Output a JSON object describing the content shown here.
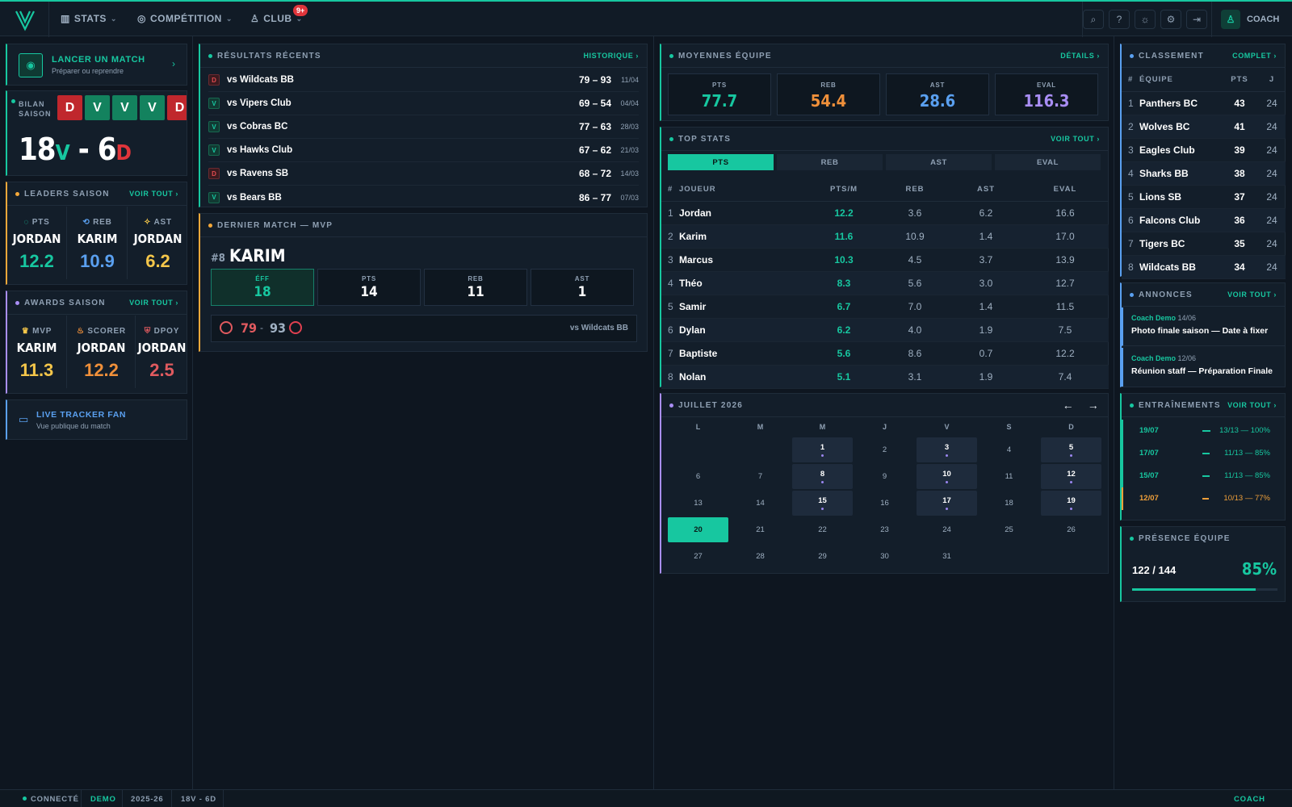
{
  "nav": {
    "stats": "STATS",
    "competition": "COMPÉTITION",
    "club": "CLUB",
    "club_badge": "9+",
    "user": "COACH"
  },
  "colors": {
    "accent": "#17c7a0",
    "loss": "#c0272d",
    "win": "#13825e",
    "orange": "#f0903a",
    "blue": "#5aa0f0",
    "purple": "#a98ef5",
    "yellow": "#f4c64a",
    "red": "#e05a5f"
  },
  "launch": {
    "title": "LANCER UN MATCH",
    "subtitle": "Préparer ou reprendre"
  },
  "bilan": {
    "label1": "BILAN",
    "label2": "SAISON",
    "form": [
      "D",
      "V",
      "V",
      "V",
      "D"
    ],
    "wins": "18",
    "win_suffix": "V",
    "dash": "-",
    "losses": "6",
    "loss_suffix": "D"
  },
  "leaders": {
    "title": "LEADERS SAISON",
    "link": "VOIR TOUT ›",
    "items": [
      {
        "label": "PTS",
        "name": "JORDAN",
        "value": "12.2"
      },
      {
        "label": "REB",
        "name": "KARIM",
        "value": "10.9"
      },
      {
        "label": "AST",
        "name": "JORDAN",
        "value": "6.2"
      }
    ]
  },
  "awards": {
    "title": "AWARDS SAISON",
    "link": "VOIR TOUT ›",
    "items": [
      {
        "label": "MVP",
        "name": "KARIM",
        "value": "11.3"
      },
      {
        "label": "SCORER",
        "name": "JORDAN",
        "value": "12.2"
      },
      {
        "label": "DPOY",
        "name": "JORDAN",
        "value": "2.5"
      }
    ]
  },
  "tracker": {
    "title": "LIVE TRACKER FAN",
    "subtitle": "Vue publique du match"
  },
  "results": {
    "title": "RÉSULTATS RÉCENTS",
    "link": "HISTORIQUE ›",
    "rows": [
      {
        "r": "D",
        "opp": "vs Wildcats BB",
        "score": "79 – 93",
        "date": "11/04"
      },
      {
        "r": "V",
        "opp": "vs Vipers Club",
        "score": "69 – 54",
        "date": "04/04"
      },
      {
        "r": "V",
        "opp": "vs Cobras BC",
        "score": "77 – 63",
        "date": "28/03"
      },
      {
        "r": "V",
        "opp": "vs Hawks Club",
        "score": "67 – 62",
        "date": "21/03"
      },
      {
        "r": "D",
        "opp": "vs Ravens SB",
        "score": "68 – 72",
        "date": "14/03"
      },
      {
        "r": "V",
        "opp": "vs Bears BB",
        "score": "86 – 77",
        "date": "07/03"
      }
    ]
  },
  "mvp": {
    "title": "DERNIER MATCH — MVP",
    "number": "#8",
    "name": "KARIM",
    "stats": [
      {
        "l": "ÉFF",
        "v": "18"
      },
      {
        "l": "PTS",
        "v": "14"
      },
      {
        "l": "REB",
        "v": "11"
      },
      {
        "l": "AST",
        "v": "1"
      }
    ],
    "score_home": "79",
    "score_sep": "-",
    "score_away": "93",
    "opponent": "vs Wildcats BB"
  },
  "averages": {
    "title": "MOYENNES ÉQUIPE",
    "link": "DÉTAILS ›",
    "items": [
      {
        "l": "PTS",
        "v": "77.7"
      },
      {
        "l": "REB",
        "v": "54.4"
      },
      {
        "l": "AST",
        "v": "28.6"
      },
      {
        "l": "EVAL",
        "v": "116.3"
      }
    ]
  },
  "topstats": {
    "title": "TOP STATS",
    "link": "VOIR TOUT ›",
    "tabs": [
      "PTS",
      "REB",
      "AST",
      "EVAL"
    ],
    "headers": [
      "#",
      "JOUEUR",
      "PTS/M",
      "REB",
      "AST",
      "EVAL"
    ],
    "rows": [
      [
        "1",
        "Jordan",
        "12.2",
        "3.6",
        "6.2",
        "16.6"
      ],
      [
        "2",
        "Karim",
        "11.6",
        "10.9",
        "1.4",
        "17.0"
      ],
      [
        "3",
        "Marcus",
        "10.3",
        "4.5",
        "3.7",
        "13.9"
      ],
      [
        "4",
        "Théo",
        "8.3",
        "5.6",
        "3.0",
        "12.7"
      ],
      [
        "5",
        "Samir",
        "6.7",
        "7.0",
        "1.4",
        "11.5"
      ],
      [
        "6",
        "Dylan",
        "6.2",
        "4.0",
        "1.9",
        "7.5"
      ],
      [
        "7",
        "Baptiste",
        "5.6",
        "8.6",
        "0.7",
        "12.2"
      ],
      [
        "8",
        "Nolan",
        "5.1",
        "3.1",
        "1.9",
        "7.4"
      ]
    ]
  },
  "calendar": {
    "title": "JUILLET 2026",
    "prev": "←",
    "next": "→",
    "days": [
      "L",
      "M",
      "M",
      "J",
      "V",
      "S",
      "D"
    ],
    "weeks": [
      [
        "",
        "",
        "1",
        "2",
        "3",
        "4",
        "5"
      ],
      [
        "6",
        "7",
        "8",
        "9",
        "10",
        "11",
        "12"
      ],
      [
        "13",
        "14",
        "15",
        "16",
        "17",
        "18",
        "19"
      ],
      [
        "20",
        "21",
        "22",
        "23",
        "24",
        "25",
        "26"
      ],
      [
        "27",
        "28",
        "29",
        "30",
        "31",
        "",
        ""
      ]
    ],
    "events": [
      "1",
      "3",
      "5",
      "8",
      "10",
      "12",
      "15",
      "17",
      "19"
    ],
    "today": "20"
  },
  "standings": {
    "title": "CLASSEMENT",
    "link": "COMPLET ›",
    "headers": [
      "#",
      "ÉQUIPE",
      "PTS",
      "J"
    ],
    "rows": [
      [
        "1",
        "Panthers BC",
        "43",
        "24"
      ],
      [
        "2",
        "Wolves BC",
        "41",
        "24"
      ],
      [
        "3",
        "Eagles Club",
        "39",
        "24"
      ],
      [
        "4",
        "Sharks BB",
        "38",
        "24"
      ],
      [
        "5",
        "Lions SB",
        "37",
        "24"
      ],
      [
        "6",
        "Falcons Club",
        "36",
        "24"
      ],
      [
        "7",
        "Tigers BC",
        "35",
        "24"
      ],
      [
        "8",
        "Wildcats BB",
        "34",
        "24"
      ]
    ]
  },
  "announcements": {
    "title": "ANNONCES",
    "link": "VOIR TOUT ›",
    "items": [
      {
        "author": "Coach Demo",
        "date": "14/06",
        "text": "Photo finale saison — Date à fixer"
      },
      {
        "author": "Coach Demo",
        "date": "12/06",
        "text": "Réunion staff — Préparation Finale"
      }
    ]
  },
  "trainings": {
    "title": "ENTRAÎNEMENTS",
    "link": "VOIR TOUT ›",
    "items": [
      {
        "date": "19/07",
        "val": "13/13 — 100%",
        "fill": 1.0
      },
      {
        "date": "17/07",
        "val": "11/13 — 85%",
        "fill": 0.85
      },
      {
        "date": "15/07",
        "val": "11/13 — 85%",
        "fill": 0.85
      },
      {
        "date": "12/07",
        "val": "10/13 — 77%",
        "fill": 0.77
      }
    ]
  },
  "presence": {
    "title": "PRÉSENCE ÉQUIPE",
    "count": "122 / 144",
    "pct": "85%",
    "fill": 0.85
  },
  "footer": {
    "status": "CONNECTÉ",
    "mode": "DEMO",
    "season": "2025-26",
    "record": "18V - 6D",
    "role": "COACH"
  }
}
